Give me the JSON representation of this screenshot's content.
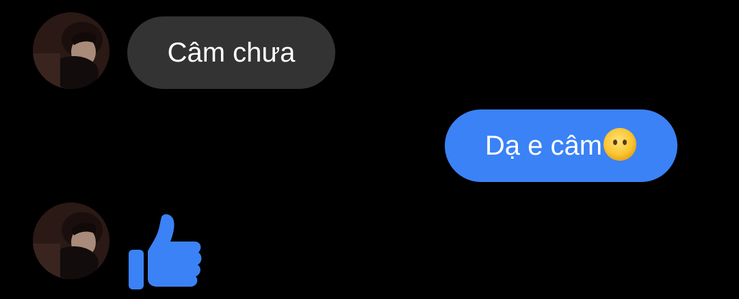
{
  "conversation": {
    "messages": [
      {
        "sender": "contact",
        "text": "Câm chưa",
        "avatar_icon": "contact-avatar"
      },
      {
        "sender": "self",
        "text": "Dạ e câm",
        "emoji_icon": "face-without-mouth-emoji"
      },
      {
        "sender": "contact",
        "sticker_icon": "thumbs-up-icon",
        "avatar_icon": "contact-avatar"
      }
    ],
    "colors": {
      "background": "#000000",
      "incoming_bubble": "#333333",
      "outgoing_bubble": "#3b82f6",
      "like_icon": "#3b82f6",
      "text": "#ffffff"
    }
  }
}
